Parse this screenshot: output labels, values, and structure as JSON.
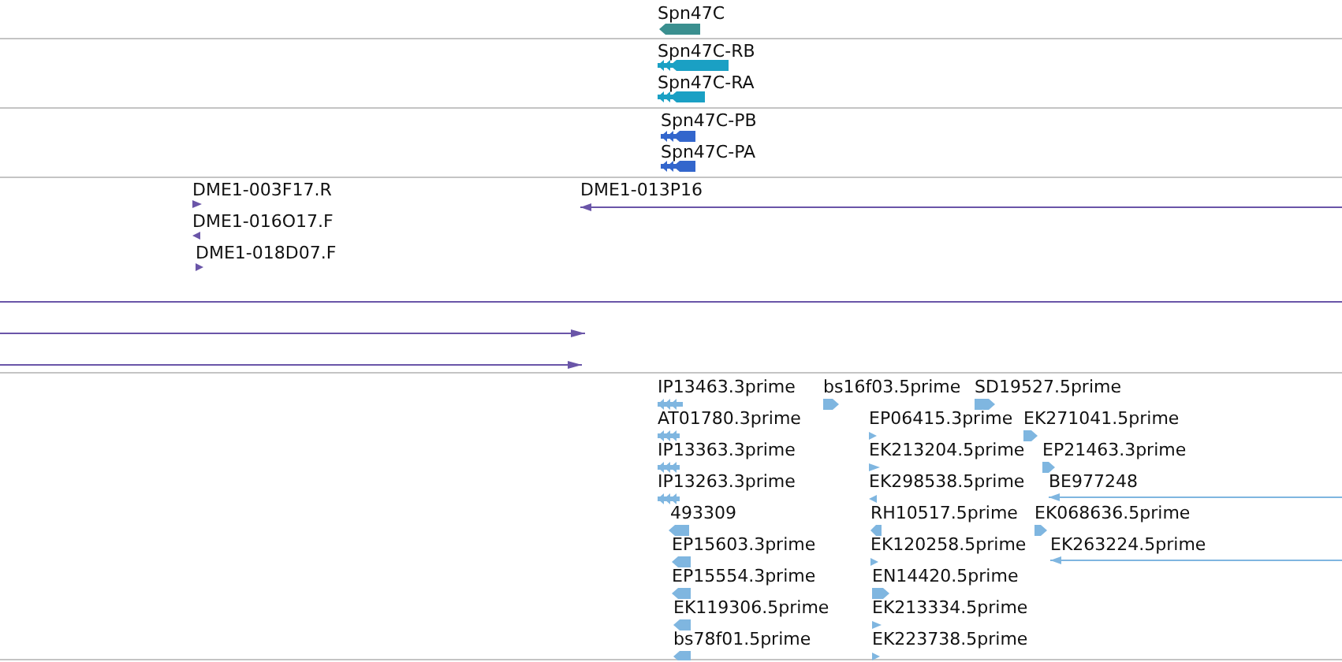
{
  "tracks": [
    {
      "color": "#3a8f8f",
      "features": [
        {
          "label": "Spn47C",
          "kind": "block",
          "reverse": true
        }
      ]
    },
    {
      "color": "#1aa0c4",
      "features": [
        {
          "label": "Spn47C-RB",
          "kind": "exons",
          "reverse": true
        },
        {
          "label": "Spn47C-RA",
          "kind": "exons",
          "reverse": true
        }
      ]
    },
    {
      "color": "#3366cc",
      "features": [
        {
          "label": "Spn47C-PB",
          "kind": "exons",
          "reverse": true
        },
        {
          "label": "Spn47C-PA",
          "kind": "exons",
          "reverse": true
        }
      ]
    },
    {
      "color": "#6a55a8",
      "features": [
        {
          "label": "DME1-003F17.R",
          "kind": "tick",
          "reverse": false
        },
        {
          "label": "DME1-016O17.F",
          "kind": "tick",
          "reverse": true
        },
        {
          "label": "DME1-018D07.F",
          "kind": "tick",
          "reverse": false
        },
        {
          "label": "DME1-013P16",
          "kind": "line",
          "reverse": true
        },
        {
          "kind": "bare"
        },
        {
          "kind": "line",
          "reverse": false
        },
        {
          "kind": "line",
          "reverse": false
        }
      ]
    },
    {
      "color": "#7fb6e0",
      "features": [
        {
          "label": "IP13463.3prime",
          "kind": "exons",
          "reverse": true
        },
        {
          "label": "AT01780.3prime",
          "kind": "exons",
          "reverse": true
        },
        {
          "label": "IP13363.3prime",
          "kind": "exons",
          "reverse": true
        },
        {
          "label": "IP13263.3prime",
          "kind": "exons",
          "reverse": true
        },
        {
          "label": "493309",
          "kind": "block",
          "reverse": true
        },
        {
          "label": "EP15603.3prime",
          "kind": "block",
          "reverse": true
        },
        {
          "label": "EP15554.3prime",
          "kind": "block",
          "reverse": true
        },
        {
          "label": "EK119306.5prime",
          "kind": "block",
          "reverse": true
        },
        {
          "label": "bs78f01.5prime",
          "kind": "block",
          "reverse": true
        },
        {
          "label": "bs16f03.5prime",
          "kind": "block",
          "reverse": false
        },
        {
          "label": "EP06415.3prime",
          "kind": "tick",
          "reverse": false
        },
        {
          "label": "EK213204.5prime",
          "kind": "tick",
          "reverse": false
        },
        {
          "label": "EK298538.5prime",
          "kind": "tick",
          "reverse": true
        },
        {
          "label": "RH10517.5prime",
          "kind": "block",
          "reverse": true
        },
        {
          "label": "EK120258.5prime",
          "kind": "tick",
          "reverse": false
        },
        {
          "label": "EN14420.5prime",
          "kind": "block",
          "reverse": false
        },
        {
          "label": "EK213334.5prime",
          "kind": "tick",
          "reverse": false
        },
        {
          "label": "EK223738.5prime",
          "kind": "tick",
          "reverse": false
        },
        {
          "label": "SD19527.5prime",
          "kind": "block",
          "reverse": false
        },
        {
          "label": "EK271041.5prime",
          "kind": "block",
          "reverse": false
        },
        {
          "label": "EP21463.3prime",
          "kind": "block",
          "reverse": false
        },
        {
          "label": "BE977248",
          "kind": "line",
          "reverse": true
        },
        {
          "label": "EK068636.5prime",
          "kind": "block",
          "reverse": false
        },
        {
          "label": "EK263224.5prime",
          "kind": "line",
          "reverse": true
        }
      ]
    }
  ]
}
